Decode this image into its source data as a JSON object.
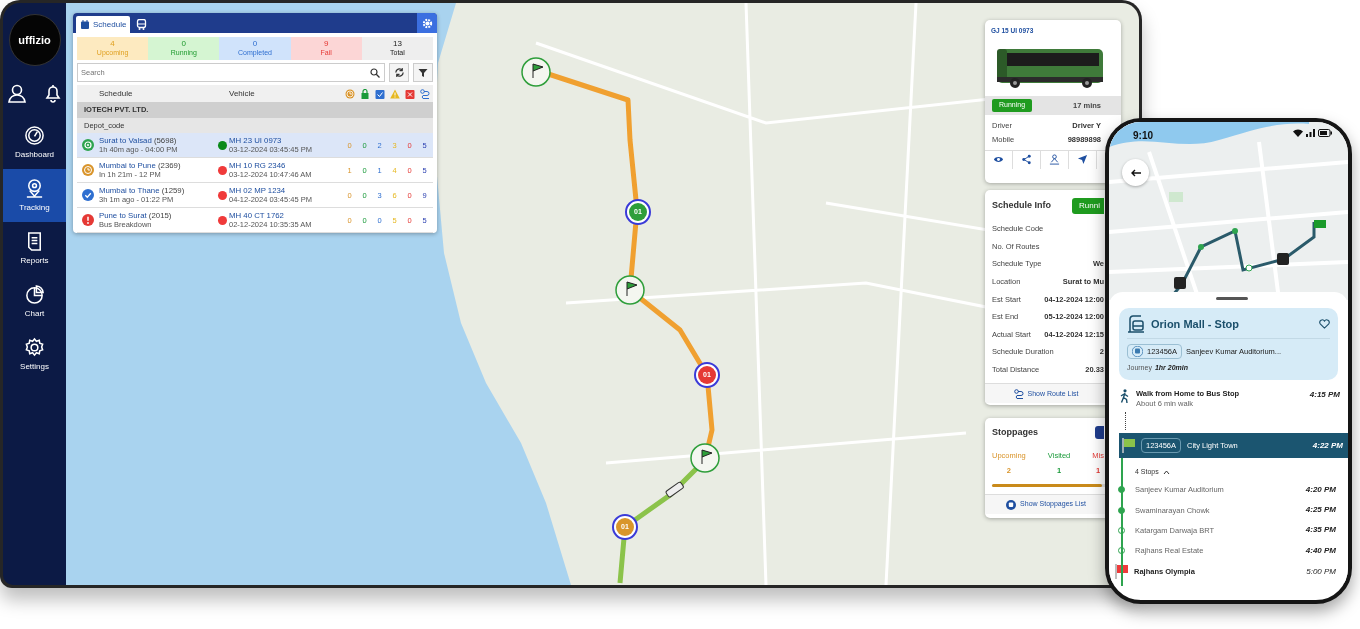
{
  "sidebar": {
    "logo": "uffizio",
    "items": [
      {
        "label": "Dashboard",
        "selected": false
      },
      {
        "label": "Tracking",
        "selected": true
      },
      {
        "label": "Reports",
        "selected": false
      },
      {
        "label": "Chart",
        "selected": false
      },
      {
        "label": "Settings",
        "selected": false
      }
    ]
  },
  "schedule_panel": {
    "tabs": [
      {
        "kind": "text",
        "label": "Schedule",
        "selected": true
      },
      {
        "kind": "bus",
        "selected": false
      }
    ],
    "stats": [
      {
        "kind": "upcoming",
        "value": "4",
        "label": "Upcoming"
      },
      {
        "kind": "running",
        "value": "0",
        "label": "Running"
      },
      {
        "kind": "completed",
        "value": "0",
        "label": "Completed"
      },
      {
        "kind": "fail",
        "value": "9",
        "label": "Fail"
      },
      {
        "kind": "total",
        "value": "13",
        "label": "Total"
      }
    ],
    "search": {
      "placeholder": "Search"
    },
    "columns": [
      "Schedule",
      "Vehicle"
    ],
    "company": "IOTECH PVT. LTD.",
    "depot": "Depot_code",
    "rows": [
      {
        "kind": "running",
        "title": "Surat to Valsad",
        "code": "(5698)",
        "time": "1h 40m ago - 04:00 PM",
        "vehicle": "MH 23 UI 0973",
        "color": "#0a8a1a",
        "timestamp": "03-12-2024 03:45:45 PM",
        "counts": [
          "0",
          "0",
          "2",
          "3",
          "0",
          "5"
        ],
        "selected": true
      },
      {
        "kind": "upcoming",
        "title": "Mumbai to Pune",
        "code": "(2369)",
        "time": "In 1h 21m - 12 PM",
        "vehicle": "MH 10 RG 2346",
        "color": "#f03a3a",
        "timestamp": "03-12-2024 10:47:46 AM",
        "counts": [
          "1",
          "0",
          "1",
          "4",
          "0",
          "5"
        ],
        "selected": false
      },
      {
        "kind": "completed",
        "title": "Mumbai to Thane",
        "code": "(1259)",
        "time": "3h 1m ago - 01:22 PM",
        "vehicle": "MH 02 MP 1234",
        "color": "#f03a3a",
        "timestamp": "04-12-2024 03:45:45 PM",
        "counts": [
          "0",
          "0",
          "3",
          "6",
          "0",
          "9"
        ],
        "selected": false
      },
      {
        "kind": "fail",
        "title": "Pune to Surat",
        "code": "(2015)",
        "time": "Bus Breakdown",
        "vehicle": "MH 40 CT 1762",
        "color": "#f03a3a",
        "timestamp": "02-12-2024 10:35:35 AM",
        "counts": [
          "0",
          "0",
          "0",
          "5",
          "0",
          "5"
        ],
        "selected": false
      }
    ]
  },
  "map": {
    "markers": [
      {
        "label": "01",
        "color": "#2e9e3a"
      },
      {
        "label": "01",
        "color": "#e53935"
      },
      {
        "label": "01",
        "color": "#d9962b"
      }
    ]
  },
  "vehicle_card": {
    "title": "GJ 15 UI 0973",
    "status": "Running",
    "duration": "17 mins",
    "fields": [
      {
        "label": "Driver",
        "value": "Driver Y"
      },
      {
        "label": "Mobile",
        "value": "98989898"
      }
    ]
  },
  "schedule_info": {
    "title": "Schedule Info",
    "status": "Runni",
    "rows": [
      {
        "label": "Schedule Code"
      },
      {
        "label": "No. Of Routes"
      },
      {
        "label": "Schedule Type",
        "value": "We"
      },
      {
        "label": "Location",
        "value": "Surat to Mu"
      },
      {
        "label": "Est Start",
        "value": "04-12-2024 12:00"
      },
      {
        "label": "Est End",
        "value": "05-12-2024 12:00"
      },
      {
        "label": "Actual Start",
        "value": "04-12-2024 12:15"
      },
      {
        "label": "Schedule Duration",
        "value": "2"
      },
      {
        "label": "Total  Distance",
        "value": "20.33"
      }
    ],
    "link": "Show Route List"
  },
  "stoppages": {
    "title": "Stoppages",
    "counts": [
      {
        "kind": "upcoming",
        "label": "Upcoming",
        "value": "2"
      },
      {
        "kind": "visited",
        "label": "Visited",
        "value": "1"
      },
      {
        "kind": "missed",
        "label": "Mis",
        "value": "1"
      }
    ],
    "progress": {
      "level": 0.85
    },
    "link": "Show Stoppages List"
  },
  "phone": {
    "time": "9:10",
    "stop": {
      "title": "Orion Mall - Stop",
      "favorite": false,
      "route_code": "123456A",
      "destination": "Sanjeev Kumar Auditorium...",
      "journey_label": "Journey",
      "journey_time": "1hr 20min"
    },
    "walk": {
      "title": "Walk from Home to Bus Stop",
      "subtitle": "About 6 min walk",
      "time": "4:15 PM"
    },
    "boarding": {
      "route_code": "123456A",
      "stop": "City Light Town",
      "time": "4:22 PM"
    },
    "stops_toggle": {
      "label": "4 Stops",
      "expanded": true
    },
    "stops": [
      {
        "name": "Sanjeev Kumar Auditorium",
        "time": "4:20 PM",
        "visited": true
      },
      {
        "name": "Swaminarayan Chowk",
        "time": "4:25 PM",
        "visited": true
      },
      {
        "name": "Katargam Darwaja BRT",
        "time": "4:35 PM",
        "visited": false
      },
      {
        "name": "Rajhans Real Estate",
        "time": "4:40 PM",
        "visited": false
      }
    ],
    "destination": {
      "name": "Rajhans Olympia",
      "time": "5:00 PM"
    }
  }
}
